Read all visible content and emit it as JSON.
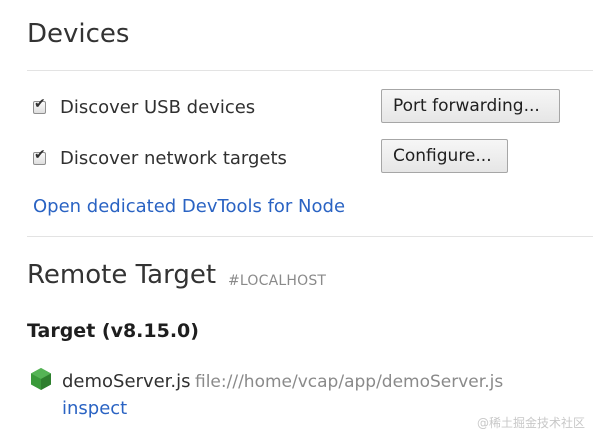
{
  "devices": {
    "title": "Devices",
    "discover_usb": {
      "label": "Discover USB devices",
      "checked": true
    },
    "discover_network": {
      "label": "Discover network targets",
      "checked": true
    },
    "port_forwarding_button": "Port forwarding...",
    "configure_button": "Configure...",
    "open_node_link": "Open dedicated DevTools for Node"
  },
  "remote_target": {
    "title": "Remote Target",
    "subtitle": "#LOCALHOST",
    "target_heading": "Target (v8.15.0)",
    "target": {
      "icon": "nodejs-hexagon-icon",
      "icon_color": "#3a9a3a",
      "name": "demoServer.js",
      "url": "file:///home/vcap/app/demoServer.js",
      "action": "inspect"
    }
  },
  "colors": {
    "link": "#2a63c3",
    "muted": "#8a8a8a"
  },
  "watermark": "@稀土掘金技术社区"
}
